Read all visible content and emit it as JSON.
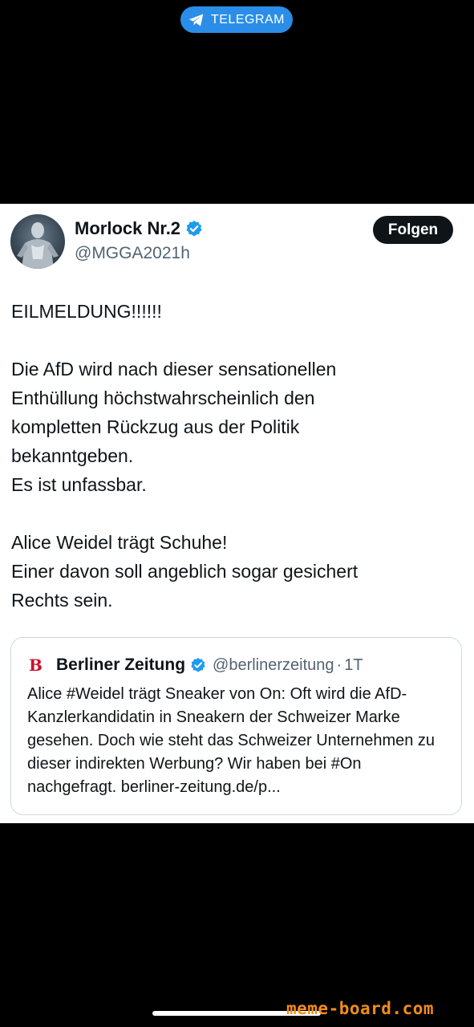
{
  "header": {
    "app_label": "TELEGRAM",
    "app_color": "#2a8ee8"
  },
  "tweet": {
    "author_name": "Morlock Nr.2",
    "author_handle": "@MGGA2021h",
    "follow_label": "Folgen",
    "verified_icon": "verified-badge-icon",
    "lines": {
      "l1": "EILMELDUNG!!!!!!",
      "l2": "Die AfD wird nach dieser sensationellen",
      "l3": "Enthüllung höchstwahrscheinlich den",
      "l4": "kompletten Rückzug aus der Politik",
      "l5": "bekanntgeben.",
      "l6": "Es ist unfassbar.",
      "l7": "Alice Weidel trägt Schuhe!",
      "l8": "Einer davon soll angeblich sogar gesichert",
      "l9": "Rechts sein."
    }
  },
  "quote": {
    "logo_glyph": "B",
    "name": "Berliner Zeitung",
    "handle": "@berlinerzeitung",
    "separator": "·",
    "time": "1T",
    "text": "Alice #Weidel trägt Sneaker von On: Oft wird die AfD-Kanzlerkandidatin in Sneakern der Schweizer Marke gesehen. Doch wie steht das Schweizer Unternehmen zu dieser indirekten Werbung? Wir haben bei #On nachgefragt. berliner-zeitung.de/p..."
  },
  "watermark": "meme-board.com",
  "colors": {
    "verified": "#1d9bf0",
    "brand_red": "#c8102e",
    "watermark": "#f28c1c"
  }
}
